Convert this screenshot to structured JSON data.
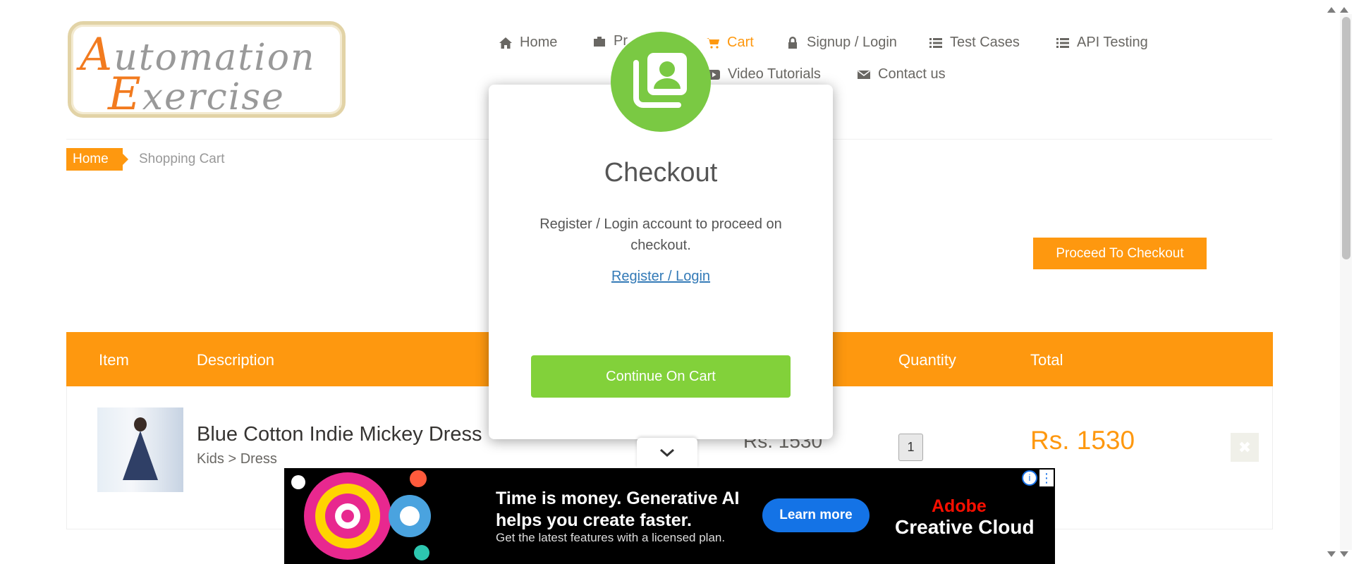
{
  "logo": {
    "line1": "utomation",
    "line1_cap": "A",
    "line2": "xercise",
    "line2_cap": "E"
  },
  "nav": {
    "home": "Home",
    "products": "Pr",
    "cart": "Cart",
    "signup": "Signup / Login",
    "test_cases": "Test Cases",
    "api_testing": "API Testing",
    "video": "Video Tutorials",
    "contact": "Contact us"
  },
  "breadcrumb": {
    "home": "Home",
    "current": "Shopping Cart"
  },
  "proceed_label": "Proceed To Checkout",
  "table": {
    "headers": {
      "item": "Item",
      "description": "Description",
      "quantity": "Quantity",
      "total": "Total"
    },
    "rows": [
      {
        "name": "Blue Cotton Indie Mickey Dress",
        "category": "Kids > Dress",
        "price": "Rs. 1530",
        "quantity": "1",
        "total": "Rs. 1530"
      }
    ]
  },
  "modal": {
    "title": "Checkout",
    "message": "Register / Login account to proceed on checkout.",
    "link": "Register / Login",
    "button": "Continue On Cart"
  },
  "ad": {
    "headline_1": "Time is money. Generative AI",
    "headline_2": "helps you create faster.",
    "subtext": "Get the latest features with a licensed plan.",
    "cta": "Learn more",
    "brand_1": "Adobe",
    "brand_2": "Creative Cloud"
  },
  "colors": {
    "accent": "#fe980f",
    "modal_icon": "#7ac943",
    "modal_button": "#82d13a",
    "ad_cta": "#1473e6",
    "adobe_red": "#fa0f00"
  },
  "icons": {
    "home": "home-icon",
    "products": "briefcase-icon",
    "cart": "shopping-cart-icon",
    "signup": "lock-icon",
    "test_cases": "list-icon",
    "api": "list-icon",
    "video": "youtube-play-icon",
    "contact": "envelope-icon",
    "modal": "user-contacts-icon",
    "delete": "close-icon"
  }
}
